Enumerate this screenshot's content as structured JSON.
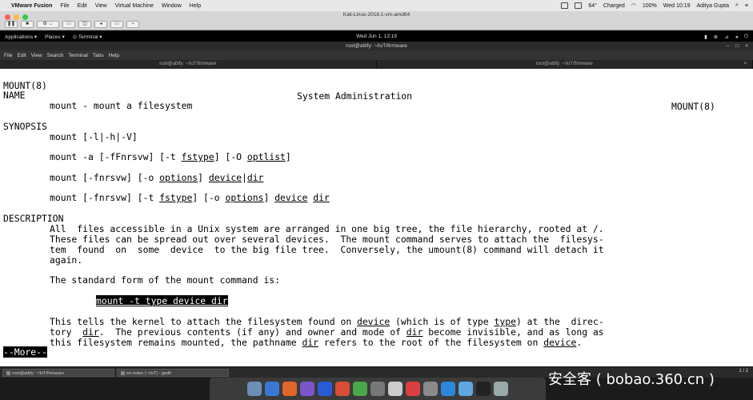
{
  "mac_menubar": {
    "apple_glyph": "",
    "app_name": "VMware Fusion",
    "menus": [
      "File",
      "Edit",
      "View",
      "Virtual Machine",
      "Window",
      "Help"
    ],
    "status": {
      "temp": "64°",
      "battery": "Charged",
      "battery_pct": "100%",
      "clock": "Wed 10:19",
      "user": "Aditya Gupta"
    }
  },
  "vmware": {
    "title": "Kali-Linux-2016.1-vm-amd64"
  },
  "gnome": {
    "applications": "Applications ▾",
    "places": "Places ▾",
    "terminal": "⊙ Terminal ▾",
    "clock": "Wed Jun 1, 13:19"
  },
  "terminal_window": {
    "title": "root@attify: ~/IoT/firmware",
    "menus": [
      "File",
      "Edit",
      "View",
      "Search",
      "Terminal",
      "Tabs",
      "Help"
    ],
    "tabs": [
      "root@attify: ~/IoT/firmware",
      "root@attify: ~/IoT/firmware"
    ]
  },
  "man": {
    "header_left": "MOUNT(8)",
    "header_center": "System Administration",
    "header_right": "MOUNT(8)",
    "name_heading": "NAME",
    "name_line": "mount - mount a filesystem",
    "synopsis_heading": "SYNOPSIS",
    "syn1": "mount [-l|-h|-V]",
    "syn2_a": "mount -a [-fFnrsvw] [-t ",
    "syn2_b": "fstype",
    "syn2_c": "] [-O ",
    "syn2_d": "optlist",
    "syn2_e": "]",
    "syn3_a": "mount [-fnrsvw] [-o ",
    "syn3_b": "options",
    "syn3_c": "] ",
    "syn3_d": "device",
    "syn3_e": "|",
    "syn3_f": "dir",
    "syn4_a": "mount [-fnrsvw] [-t ",
    "syn4_b": "fstype",
    "syn4_c": "] [-o ",
    "syn4_d": "options",
    "syn4_e": "] ",
    "syn4_f": "device",
    "syn4_g": " ",
    "syn4_h": "dir",
    "description_heading": "DESCRIPTION",
    "desc1": "All  files accessible in a Unix system are arranged in one big tree, the file hierarchy, rooted at /.",
    "desc2": "These files can be spread out over several devices.  The mount command serves to attach the  filesys-",
    "desc3": "tem  found  on  some  device  to the big file tree.  Conversely, the umount(8) command will detach it",
    "desc4": "again.",
    "std_form": "The standard form of the mount command is:",
    "std_cmd": "mount -t type device dir",
    "p2l1_a": "This tells the kernel to attach the filesystem found on ",
    "p2l1_b": "device",
    "p2l1_c": " (which is of type ",
    "p2l1_d": "type",
    "p2l1_e": ") at the  direc-",
    "p2l2_a": "tory  ",
    "p2l2_b": "dir",
    "p2l2_c": ".  The previous contents (if any) and owner and mode of ",
    "p2l2_d": "dir",
    "p2l2_e": " become invisible, and as long as",
    "p2l3_a": "this filesystem remains mounted, the pathname ",
    "p2l3_b": "dir",
    "p2l3_c": " refers to the root of the filesystem on ",
    "p2l3_d": "device",
    "p2l3_e": ".",
    "more_prompt": "--More--"
  },
  "taskbar": {
    "tasks": [
      "root@attify: ~/IoT/firmware",
      "iot-notes (~/IoT) - gedit"
    ],
    "pager": "1 / 2"
  },
  "watermark": "安全客 ( bobao.360.cn )",
  "colors": {
    "terminal_bg": "#ffffff",
    "terminal_fg": "#000000",
    "gnome_bar": "#000000"
  }
}
